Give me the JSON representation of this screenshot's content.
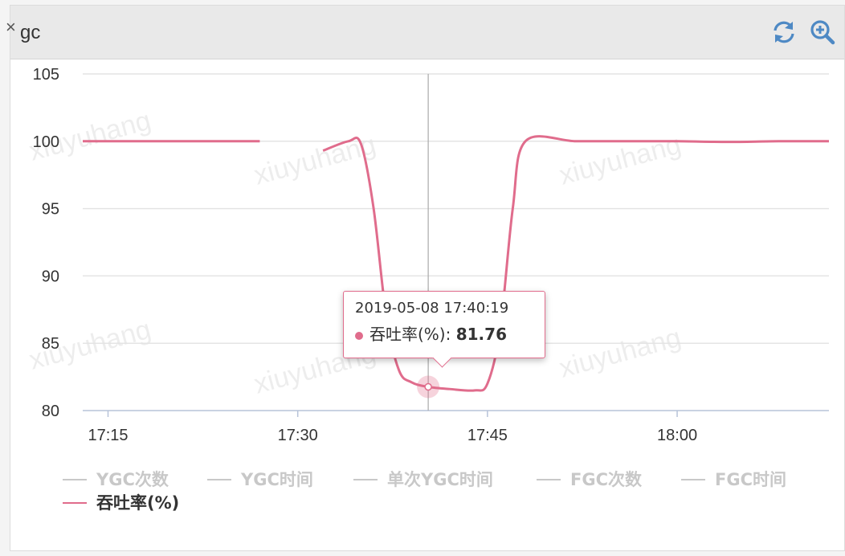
{
  "panel": {
    "title": "gc",
    "close_glyph": "×",
    "tools": [
      {
        "name": "refresh-icon",
        "label": "refresh"
      },
      {
        "name": "zoom-icon",
        "label": "zoom"
      }
    ]
  },
  "watermark": "xiuyuhang",
  "colors": {
    "series": "#e06c8c",
    "legend_inactive": "#c8c8c8",
    "grid": "#e4e4e4",
    "axis": "#b7c3d9",
    "text": "#333333",
    "tool": "#4e89c4"
  },
  "chart_data": {
    "type": "line",
    "xlabel": "",
    "ylabel": "",
    "ylim": [
      80,
      105
    ],
    "y_ticks": [
      "80",
      "85",
      "90",
      "95",
      "100",
      "105"
    ],
    "x_ticks": [
      "17:15",
      "17:30",
      "17:45",
      "18:00"
    ],
    "xlim": [
      "17:13",
      "18:12"
    ],
    "grid": true,
    "legend_position": "bottom",
    "legend": [
      {
        "label": "YGC次数",
        "active": false
      },
      {
        "label": "YGC时间",
        "active": false
      },
      {
        "label": "单次YGC时间",
        "active": false
      },
      {
        "label": "FGC次数",
        "active": false
      },
      {
        "label": "FGC时间",
        "active": false
      },
      {
        "label": "吞吐率(%)",
        "active": true
      }
    ],
    "series": [
      {
        "name": "吞吐率(%)",
        "segments": [
          {
            "x": [
              "17:13",
              "17:27"
            ],
            "y": [
              100,
              100
            ]
          },
          {
            "x": [
              "17:32",
              "17:34",
              "17:35",
              "17:36",
              "17:37",
              "17:38",
              "17:39",
              "17:40:19",
              "17:42",
              "17:44",
              "17:45",
              "17:46",
              "17:47",
              "17:48",
              "17:52",
              "17:56",
              "18:00",
              "18:04",
              "18:08",
              "18:12"
            ],
            "y": [
              99.3,
              100,
              99.8,
              95,
              87,
              83,
              82.1,
              81.76,
              81.6,
              81.5,
              82,
              86,
              95,
              100,
              100,
              100,
              100,
              99.95,
              100,
              100
            ]
          }
        ]
      }
    ],
    "tooltip": {
      "date": "2019-05-08 17:40:19",
      "series": "吞吐率(%)",
      "value": "81.76",
      "x": "17:40:19",
      "y": 81.76
    }
  }
}
